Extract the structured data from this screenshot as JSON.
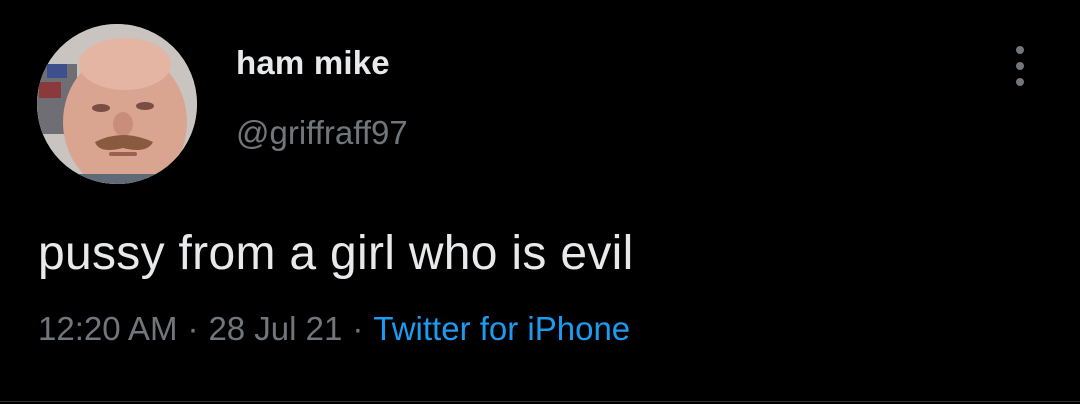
{
  "author": {
    "display_name": "ham mike",
    "handle": "@griffraff97",
    "avatar_icon": "profile-photo"
  },
  "tweet": {
    "text": "pussy from a girl who is evil",
    "time": "12:20 AM",
    "date": "28 Jul 21",
    "separator": "·",
    "source": "Twitter for iPhone"
  },
  "menu": {
    "icon": "more-vertical-icon"
  },
  "colors": {
    "background": "#000000",
    "text_primary": "#e7e9ea",
    "text_secondary": "#71767b",
    "link": "#1d9bf0"
  }
}
